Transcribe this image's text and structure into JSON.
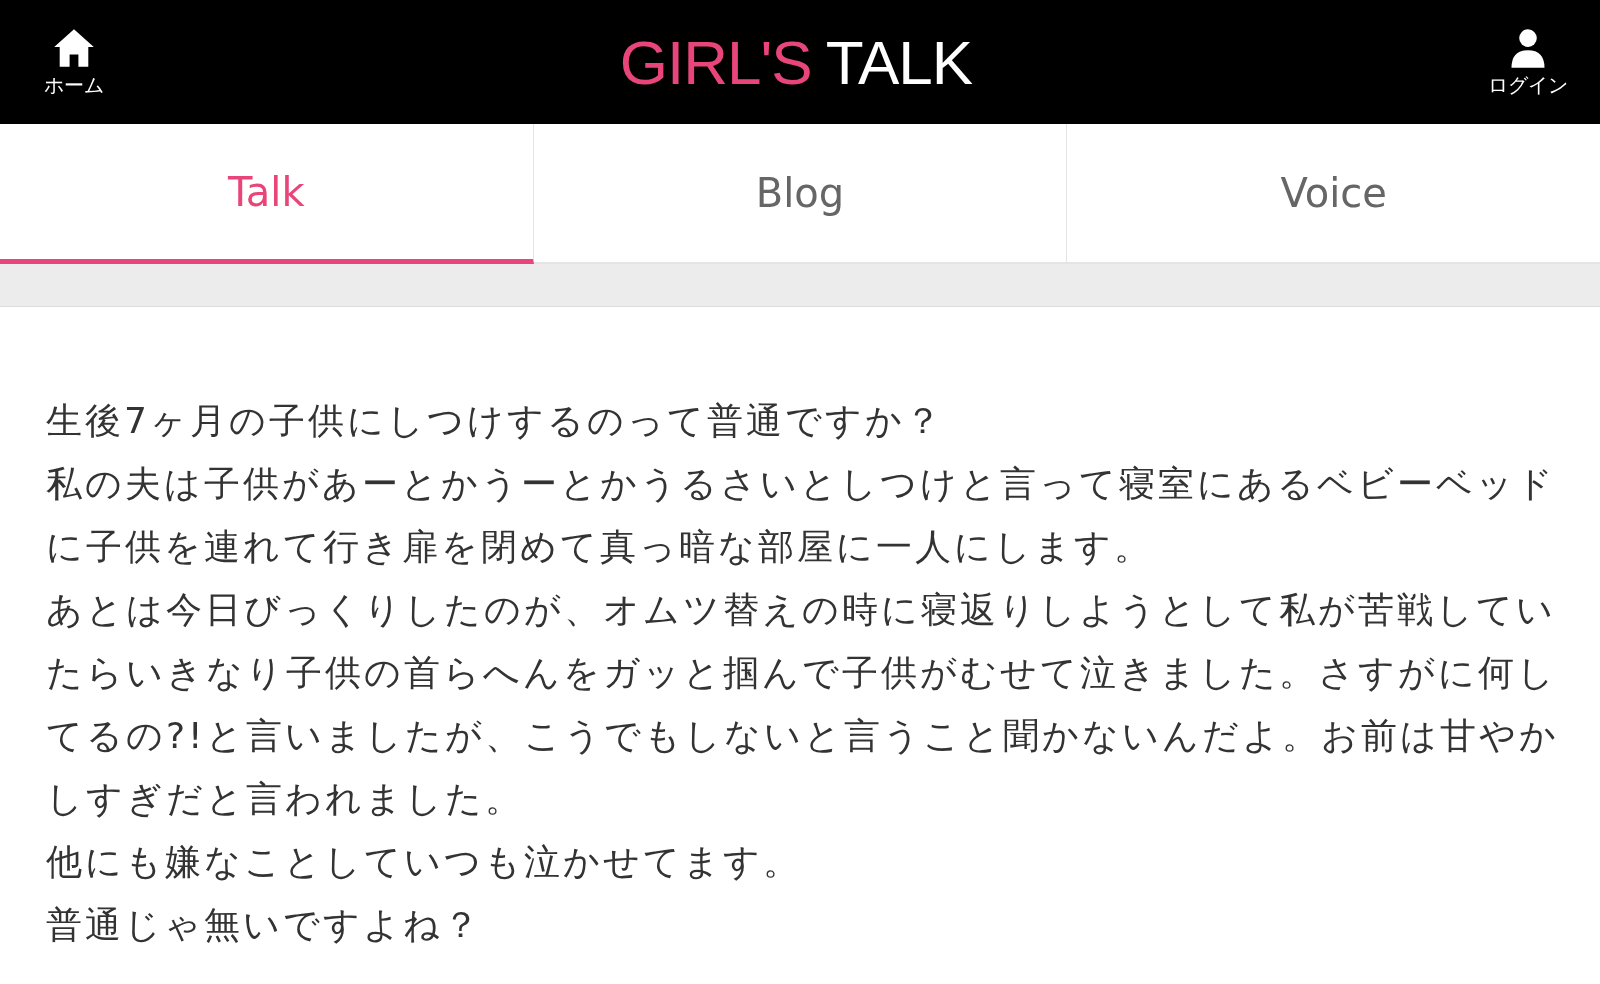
{
  "header": {
    "home": {
      "label": "ホーム"
    },
    "logo": {
      "part_1": "GIRL'S",
      "part_2": "TALK"
    },
    "login": {
      "label": "ログイン"
    }
  },
  "tabs": [
    {
      "label": "Talk",
      "selected": true
    },
    {
      "label": "Blog",
      "selected": false
    },
    {
      "label": "Voice",
      "selected": false
    }
  ],
  "post": {
    "paragraphs": [
      "生後7ヶ月の子供にしつけするのって普通ですか？",
      "私の夫は子供があーとかうーとかうるさいとしつけと言って寝室にあるベビーベッドに子供を連れて行き扉を閉めて真っ暗な部屋に一人にします。",
      "あとは今日びっくりしたのが、オムツ替えの時に寝返りしようとして私が苦戦していたらいきなり子供の首らへんをガッと掴んで子供がむせて泣きました。さすがに何してるの?!と言いましたが、こうでもしないと言うこと聞かないんだよ。お前は甘やかしすぎだと言われました。",
      "他にも嫌なことしていつも泣かせてます。",
      "普通じゃ無いですよね？"
    ]
  }
}
